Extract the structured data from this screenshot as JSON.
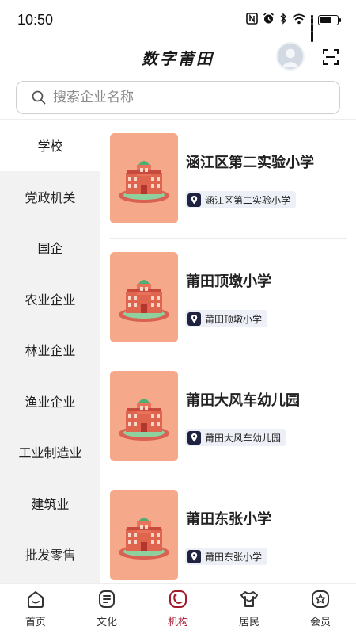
{
  "status_bar": {
    "time": "10:50",
    "icons": [
      "nfc-icon",
      "alarm-icon",
      "bluetooth-icon",
      "wifi-icon",
      "signal-icon",
      "battery-icon"
    ]
  },
  "header": {
    "title": "数字莆田",
    "avatar_icon": "user-avatar-icon",
    "scan_icon": "scan-icon"
  },
  "search": {
    "placeholder": "搜索企业名称",
    "value": ""
  },
  "sidebar": {
    "active_index": 0,
    "items": [
      {
        "label": "学校"
      },
      {
        "label": "党政机关"
      },
      {
        "label": "国企"
      },
      {
        "label": "农业企业"
      },
      {
        "label": "林业企业"
      },
      {
        "label": "渔业企业"
      },
      {
        "label": "工业制造业"
      },
      {
        "label": "建筑业"
      },
      {
        "label": "批发零售"
      }
    ]
  },
  "list": {
    "items": [
      {
        "title": "涵江区第二实验小学",
        "tag": "涵江区第二实验小学",
        "thumb_icon": "school-building-icon",
        "tag_icon": "location-pin-icon"
      },
      {
        "title": "莆田顶墩小学",
        "tag": "莆田顶墩小学",
        "thumb_icon": "school-building-icon",
        "tag_icon": "location-pin-icon"
      },
      {
        "title": "莆田大风车幼儿园",
        "tag": "莆田大风车幼儿园",
        "thumb_icon": "school-building-icon",
        "tag_icon": "location-pin-icon"
      },
      {
        "title": "莆田东张小学",
        "tag": "莆田东张小学",
        "thumb_icon": "school-building-icon",
        "tag_icon": "location-pin-icon"
      }
    ]
  },
  "bottom_nav": {
    "active_index": 2,
    "items": [
      {
        "label": "首页",
        "icon": "home-icon"
      },
      {
        "label": "文化",
        "icon": "culture-icon"
      },
      {
        "label": "机构",
        "icon": "organization-icon"
      },
      {
        "label": "居民",
        "icon": "resident-icon"
      },
      {
        "label": "会员",
        "icon": "member-icon"
      }
    ]
  },
  "colors": {
    "accent": "#a31a2c",
    "thumb_bg": "#f6a98a",
    "tag_bg": "#eef0f8",
    "sidebar_bg": "#f2f2f2"
  }
}
